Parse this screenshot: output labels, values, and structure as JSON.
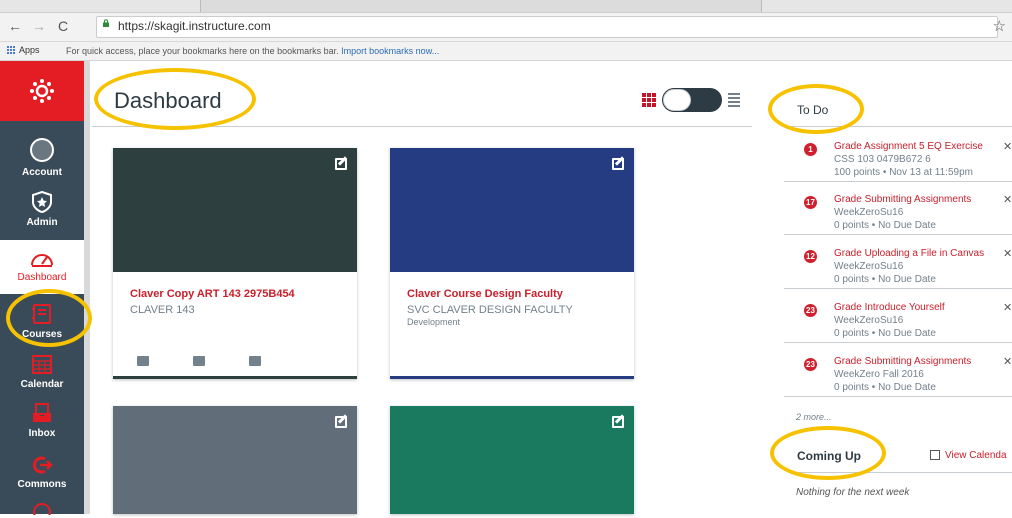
{
  "browser": {
    "url": "https://skagit.instructure.com",
    "back_icon": "←",
    "forward_icon": "→",
    "reload_icon": "C",
    "star_icon": "☆"
  },
  "bookmarks": {
    "apps_label": "Apps",
    "message": "For quick access, place your bookmarks here on the bookmarks bar.",
    "import_link": "Import bookmarks now..."
  },
  "global_nav": {
    "items": [
      {
        "label": "Account",
        "icon": "account-icon"
      },
      {
        "label": "Admin",
        "icon": "admin-icon"
      },
      {
        "label": "Dashboard",
        "icon": "dashboard-icon"
      },
      {
        "label": "Courses",
        "icon": "courses-icon"
      },
      {
        "label": "Calendar",
        "icon": "calendar-icon"
      },
      {
        "label": "Inbox",
        "icon": "inbox-icon"
      },
      {
        "label": "Commons",
        "icon": "commons-icon"
      }
    ]
  },
  "dashboard": {
    "title": "Dashboard",
    "cards": [
      {
        "title": "Claver Copy ART 143 2975B454",
        "subtitle": "CLAVER 143",
        "term": "",
        "color": "#2d3f3e"
      },
      {
        "title": "Claver Course Design Faculty",
        "subtitle": "SVC CLAVER DESIGN FACULTY",
        "term": "Development",
        "color": "#253b82"
      },
      {
        "title": "",
        "subtitle": "",
        "term": "",
        "color": "#626d7a"
      },
      {
        "title": "",
        "subtitle": "",
        "term": "",
        "color": "#1a7a60"
      }
    ]
  },
  "todo": {
    "title": "To Do",
    "items": [
      {
        "badge": "1",
        "title": "Grade Assignment 5 EQ Exercise",
        "course": "CSS 103 0479B672 6",
        "meta": "100 points • Nov 13 at 11:59pm"
      },
      {
        "badge": "17",
        "title": "Grade Submitting Assignments",
        "course": "WeekZeroSu16",
        "meta": "0 points • No Due Date"
      },
      {
        "badge": "12",
        "title": "Grade Uploading a File in Canvas",
        "course": "WeekZeroSu16",
        "meta": "0 points • No Due Date"
      },
      {
        "badge": "23",
        "title": "Grade Introduce Yourself",
        "course": "WeekZeroSu16",
        "meta": "0 points • No Due Date"
      },
      {
        "badge": "23",
        "title": "Grade Submitting Assignments",
        "course": "WeekZero Fall 2016",
        "meta": "0 points • No Due Date"
      }
    ],
    "more": "2 more..."
  },
  "coming_up": {
    "title": "Coming Up",
    "view_calendar": "View Calenda",
    "empty": "Nothing for the next week"
  },
  "colors": {
    "accent": "#e31d23",
    "nav_bg": "#394b58",
    "highlight_circle": "#f6c200"
  }
}
